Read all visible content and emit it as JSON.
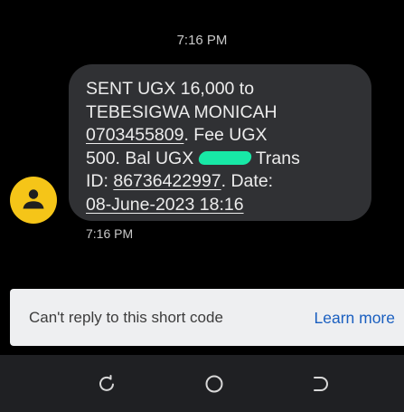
{
  "thread": {
    "date_header": "7:16 PM",
    "message": {
      "lines": [
        [
          "SENT UGX 16,000 to"
        ],
        [
          "TEBESIGWA MONICAH"
        ],
        [
          "0703455809",
          ". Fee UGX"
        ],
        [
          "500. Bal UGX",
          " Trans"
        ],
        [
          "ID: ",
          "86736422997",
          ". Date:"
        ],
        [
          "08-June-2023 18:16"
        ]
      ],
      "time": "7:16 PM"
    },
    "sender_avatar_color": "#f5c518",
    "bubble_color": "#303134",
    "redaction_color": "#18e8a6"
  },
  "reply_bar": {
    "notice": "Can't reply to this short code",
    "action_label": "Learn more"
  },
  "navbar": {
    "icons": [
      "recent-apps-icon",
      "home-icon",
      "back-icon"
    ]
  }
}
